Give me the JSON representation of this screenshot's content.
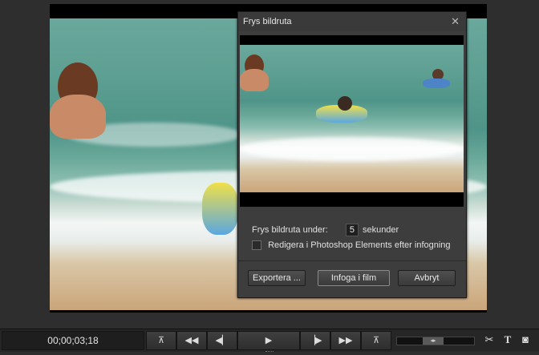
{
  "dialog": {
    "title": "Frys bildruta",
    "close_icon": "close-icon",
    "freeze_label": "Frys bildruta under:",
    "freeze_value": "5",
    "freeze_unit": "sekunder",
    "edit_checkbox_label": "Redigera i Photoshop Elements efter infogning",
    "edit_checked": false,
    "buttons": {
      "export": "Exportera ...",
      "insert": "Infoga i film",
      "cancel": "Avbryt"
    }
  },
  "transport": {
    "timecode": "00;00;03;18",
    "icons": [
      "set-in-icon",
      "rewind-icon",
      "step-back-icon",
      "play-icon",
      "step-forward-icon",
      "fast-forward-icon",
      "set-out-icon"
    ],
    "glyphs": [
      "⊼",
      "◀◀",
      "◀▏",
      "▶",
      "▕▶",
      "▶▶",
      "⊼"
    ],
    "shuttle_glyph": "◂▸"
  },
  "tools": {
    "split_glyph": "✂",
    "title_glyph": "T",
    "freeze_glyph": "◙"
  }
}
